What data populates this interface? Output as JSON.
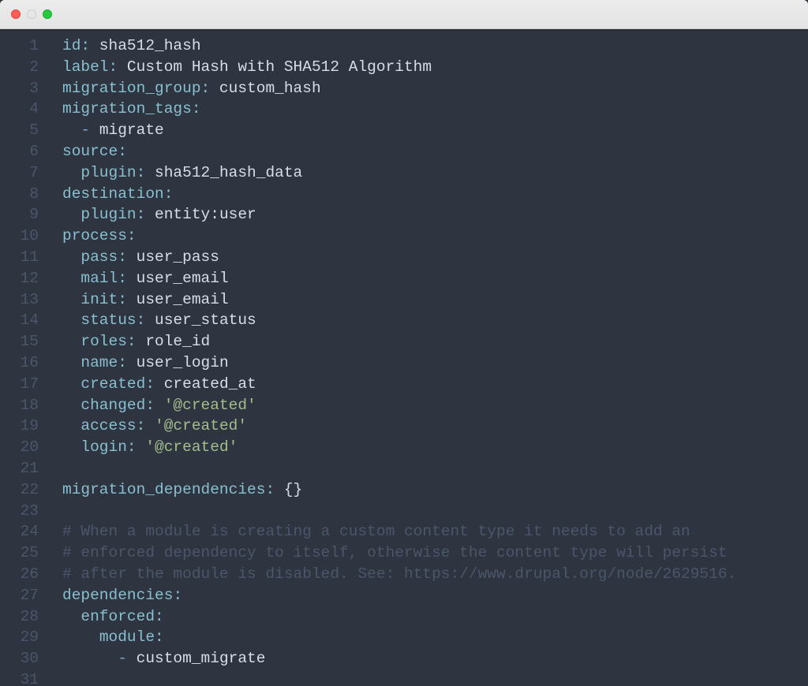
{
  "traffic_lights": {
    "close": "close",
    "min": "minimize",
    "max": "maximize"
  },
  "lines": [
    {
      "n": 1,
      "segments": [
        {
          "cls": "tok-key",
          "t": "id"
        },
        {
          "cls": "tok-colon",
          "t": ":"
        },
        {
          "cls": "tok-val",
          "t": " sha512_hash"
        }
      ]
    },
    {
      "n": 2,
      "segments": [
        {
          "cls": "tok-key",
          "t": "label"
        },
        {
          "cls": "tok-colon",
          "t": ":"
        },
        {
          "cls": "tok-val",
          "t": " Custom Hash with SHA512 Algorithm"
        }
      ]
    },
    {
      "n": 3,
      "segments": [
        {
          "cls": "tok-key",
          "t": "migration_group"
        },
        {
          "cls": "tok-colon",
          "t": ":"
        },
        {
          "cls": "tok-val",
          "t": " custom_hash"
        }
      ]
    },
    {
      "n": 4,
      "segments": [
        {
          "cls": "tok-key",
          "t": "migration_tags"
        },
        {
          "cls": "tok-colon",
          "t": ":"
        }
      ]
    },
    {
      "n": 5,
      "indent": 1,
      "segments": [
        {
          "cls": "tok-dash",
          "t": "- "
        },
        {
          "cls": "tok-val",
          "t": "migrate"
        }
      ]
    },
    {
      "n": 6,
      "segments": [
        {
          "cls": "tok-key",
          "t": "source"
        },
        {
          "cls": "tok-colon",
          "t": ":"
        }
      ]
    },
    {
      "n": 7,
      "indent": 1,
      "segments": [
        {
          "cls": "tok-key",
          "t": "plugin"
        },
        {
          "cls": "tok-colon",
          "t": ":"
        },
        {
          "cls": "tok-val",
          "t": " sha512_hash_data"
        }
      ]
    },
    {
      "n": 8,
      "segments": [
        {
          "cls": "tok-key",
          "t": "destination"
        },
        {
          "cls": "tok-colon",
          "t": ":"
        }
      ]
    },
    {
      "n": 9,
      "indent": 1,
      "segments": [
        {
          "cls": "tok-key",
          "t": "plugin"
        },
        {
          "cls": "tok-colon",
          "t": ":"
        },
        {
          "cls": "tok-val",
          "t": " entity:user"
        }
      ]
    },
    {
      "n": 10,
      "segments": [
        {
          "cls": "tok-key",
          "t": "process"
        },
        {
          "cls": "tok-colon",
          "t": ":"
        }
      ]
    },
    {
      "n": 11,
      "indent": 1,
      "segments": [
        {
          "cls": "tok-key",
          "t": "pass"
        },
        {
          "cls": "tok-colon",
          "t": ":"
        },
        {
          "cls": "tok-val",
          "t": " user_pass"
        }
      ]
    },
    {
      "n": 12,
      "indent": 1,
      "segments": [
        {
          "cls": "tok-key",
          "t": "mail"
        },
        {
          "cls": "tok-colon",
          "t": ":"
        },
        {
          "cls": "tok-val",
          "t": " user_email"
        }
      ]
    },
    {
      "n": 13,
      "indent": 1,
      "segments": [
        {
          "cls": "tok-key",
          "t": "init"
        },
        {
          "cls": "tok-colon",
          "t": ":"
        },
        {
          "cls": "tok-val",
          "t": " user_email"
        }
      ]
    },
    {
      "n": 14,
      "indent": 1,
      "segments": [
        {
          "cls": "tok-key",
          "t": "status"
        },
        {
          "cls": "tok-colon",
          "t": ":"
        },
        {
          "cls": "tok-val",
          "t": " user_status"
        }
      ]
    },
    {
      "n": 15,
      "indent": 1,
      "segments": [
        {
          "cls": "tok-key",
          "t": "roles"
        },
        {
          "cls": "tok-colon",
          "t": ":"
        },
        {
          "cls": "tok-val",
          "t": " role_id"
        }
      ]
    },
    {
      "n": 16,
      "indent": 1,
      "segments": [
        {
          "cls": "tok-key",
          "t": "name"
        },
        {
          "cls": "tok-colon",
          "t": ":"
        },
        {
          "cls": "tok-val",
          "t": " user_login"
        }
      ]
    },
    {
      "n": 17,
      "indent": 1,
      "segments": [
        {
          "cls": "tok-key",
          "t": "created"
        },
        {
          "cls": "tok-colon",
          "t": ":"
        },
        {
          "cls": "tok-val",
          "t": " created_at"
        }
      ]
    },
    {
      "n": 18,
      "indent": 1,
      "segments": [
        {
          "cls": "tok-key",
          "t": "changed"
        },
        {
          "cls": "tok-colon",
          "t": ":"
        },
        {
          "cls": "tok-val",
          "t": " "
        },
        {
          "cls": "tok-str",
          "t": "'@created'"
        }
      ]
    },
    {
      "n": 19,
      "indent": 1,
      "segments": [
        {
          "cls": "tok-key",
          "t": "access"
        },
        {
          "cls": "tok-colon",
          "t": ":"
        },
        {
          "cls": "tok-val",
          "t": " "
        },
        {
          "cls": "tok-str",
          "t": "'@created'"
        }
      ]
    },
    {
      "n": 20,
      "indent": 1,
      "segments": [
        {
          "cls": "tok-key",
          "t": "login"
        },
        {
          "cls": "tok-colon",
          "t": ":"
        },
        {
          "cls": "tok-val",
          "t": " "
        },
        {
          "cls": "tok-str",
          "t": "'@created'"
        }
      ]
    },
    {
      "n": 21,
      "segments": []
    },
    {
      "n": 22,
      "segments": [
        {
          "cls": "tok-key",
          "t": "migration_dependencies"
        },
        {
          "cls": "tok-colon",
          "t": ":"
        },
        {
          "cls": "tok-val",
          "t": " "
        },
        {
          "cls": "tok-brace",
          "t": "{}"
        }
      ]
    },
    {
      "n": 23,
      "segments": []
    },
    {
      "n": 24,
      "segments": [
        {
          "cls": "tok-comment",
          "t": "# When a module is creating a custom content type it needs to add an"
        }
      ]
    },
    {
      "n": 25,
      "segments": [
        {
          "cls": "tok-comment",
          "t": "# enforced dependency to itself, otherwise the content type will persist"
        }
      ]
    },
    {
      "n": 26,
      "segments": [
        {
          "cls": "tok-comment",
          "t": "# after the module is disabled. See: https://www.drupal.org/node/2629516."
        }
      ]
    },
    {
      "n": 27,
      "segments": [
        {
          "cls": "tok-key",
          "t": "dependencies"
        },
        {
          "cls": "tok-colon",
          "t": ":"
        }
      ]
    },
    {
      "n": 28,
      "indent": 1,
      "segments": [
        {
          "cls": "tok-key",
          "t": "enforced"
        },
        {
          "cls": "tok-colon",
          "t": ":"
        }
      ]
    },
    {
      "n": 29,
      "indent": 2,
      "segments": [
        {
          "cls": "tok-key",
          "t": "module"
        },
        {
          "cls": "tok-colon",
          "t": ":"
        }
      ]
    },
    {
      "n": 30,
      "indent": 3,
      "segments": [
        {
          "cls": "tok-dash",
          "t": "- "
        },
        {
          "cls": "tok-val",
          "t": "custom_migrate"
        }
      ]
    },
    {
      "n": 31,
      "segments": []
    }
  ]
}
